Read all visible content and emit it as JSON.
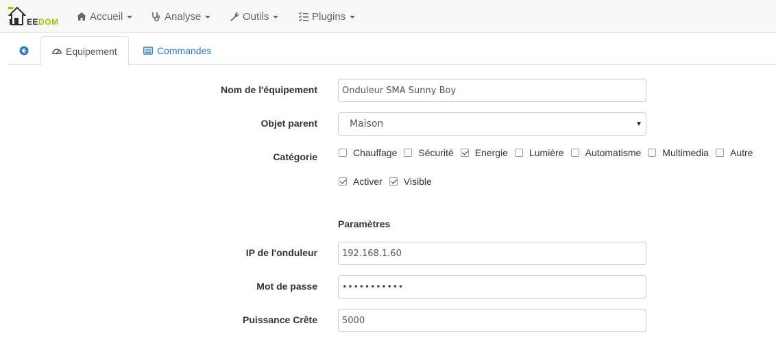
{
  "navbar": {
    "logo_text_main": "EE",
    "logo_text_accent": "DOM",
    "items": [
      {
        "label": "Accueil",
        "icon": "home-icon"
      },
      {
        "label": "Analyse",
        "icon": "stethoscope-icon"
      },
      {
        "label": "Outils",
        "icon": "wrench-icon"
      },
      {
        "label": "Plugins",
        "icon": "tasks-icon"
      }
    ]
  },
  "tabs": {
    "back_icon": "arrow-circle-left-icon",
    "items": [
      {
        "label": "Equipement",
        "icon": "tachometer-icon",
        "active": true
      },
      {
        "label": "Commandes",
        "icon": "list-alt-icon",
        "active": false
      }
    ]
  },
  "form": {
    "name": {
      "label": "Nom de l'équipement",
      "value": "Onduleur SMA Sunny Boy"
    },
    "parent": {
      "label": "Objet parent",
      "value": "Maison"
    },
    "category": {
      "label": "Catégorie",
      "options": [
        {
          "label": "Chauffage",
          "checked": false
        },
        {
          "label": "Sécurité",
          "checked": false
        },
        {
          "label": "Energie",
          "checked": true
        },
        {
          "label": "Lumière",
          "checked": false
        },
        {
          "label": "Automatisme",
          "checked": false
        },
        {
          "label": "Multimedia",
          "checked": false
        },
        {
          "label": "Autre",
          "checked": false
        }
      ]
    },
    "flags": [
      {
        "label": "Activer",
        "checked": true
      },
      {
        "label": "Visible",
        "checked": true
      }
    ],
    "params_title": "Paramètres",
    "ip": {
      "label": "IP de l'onduleur",
      "value": "192.168.1.60"
    },
    "password": {
      "label": "Mot de passe",
      "value": "•••••••••••"
    },
    "peak_power": {
      "label": "Puissance Crête",
      "value": "5000"
    }
  },
  "colors": {
    "accent": "#94ca02",
    "link": "#337ab7"
  }
}
